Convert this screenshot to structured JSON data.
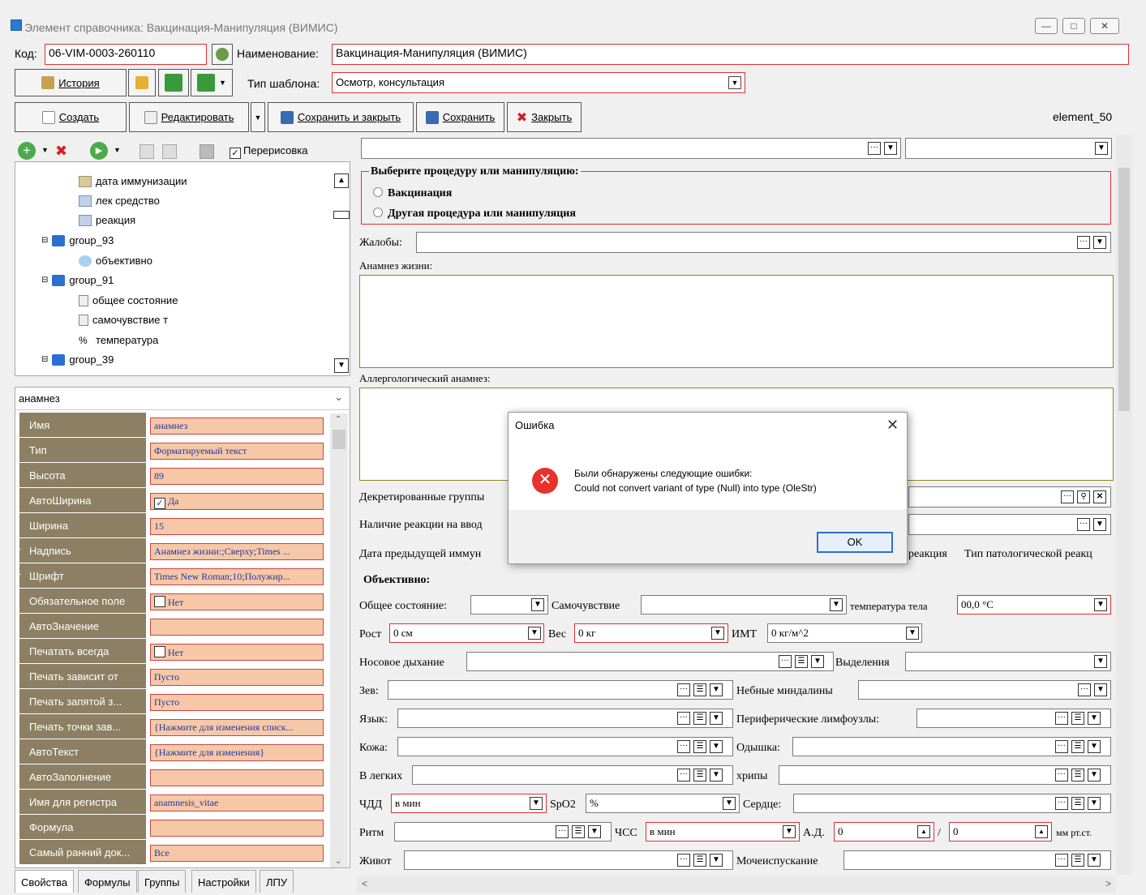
{
  "window": {
    "title": "Элемент справочника: Вакцинация-Манипуляция (ВИМИС)"
  },
  "header": {
    "code_label": "Код:",
    "code_value": "06-VIM-0003-260110",
    "name_label": "Наименование:",
    "name_value": "Вакцинация-Манипуляция (ВИМИС)",
    "history_label": "История",
    "template_type_label": "Тип шаблона:",
    "template_type_value": "Осмотр, консультация"
  },
  "toolbar": {
    "create_label": "Создать",
    "edit_label": "Редактировать",
    "save_close_label": "Сохранить и закрыть",
    "save_label": "Сохранить",
    "close_label": "Закрыть",
    "element_id": "element_50",
    "redraw_label": "Перерисовка"
  },
  "tree": {
    "items": [
      {
        "label": "дата иммунизации",
        "icon": "calendar-icon"
      },
      {
        "label": "лек средство",
        "icon": "list-icon"
      },
      {
        "label": "реакция",
        "icon": "list-icon"
      },
      {
        "label": "group_93",
        "icon": "folder-icon"
      },
      {
        "label": "объективно",
        "icon": "speech-icon"
      },
      {
        "label": "group_91",
        "icon": "folder-icon"
      },
      {
        "label": "общее состояние",
        "icon": "document-icon"
      },
      {
        "label": "самочувствие т",
        "icon": "document-icon"
      },
      {
        "label": "температура",
        "icon": "percent-icon"
      },
      {
        "label": "group_39",
        "icon": "folder-icon"
      }
    ]
  },
  "props": {
    "selector_value": "анамнез",
    "rows": [
      {
        "name": "Имя",
        "value": "анамнез"
      },
      {
        "name": "Тип",
        "value": "Форматируемый текст"
      },
      {
        "name": "Высота",
        "value": "89"
      },
      {
        "name": "АвтоШирина",
        "value": "Да",
        "checked": true
      },
      {
        "name": "Ширина",
        "value": "15"
      },
      {
        "name": "Надпись",
        "value": "Анамнез жизни:;Сверху;Times ..."
      },
      {
        "name": "Шрифт",
        "value": "Times New Roman;10;Полужир..."
      },
      {
        "name": "Обязательное поле",
        "value": "Нет",
        "checked": false
      },
      {
        "name": "АвтоЗначение",
        "value": ""
      },
      {
        "name": "Печатать всегда",
        "value": "Нет",
        "checked": false
      },
      {
        "name": "Печать зависит от",
        "value": "Пусто"
      },
      {
        "name": "Печать запятой з...",
        "value": "Пусто"
      },
      {
        "name": "Печать точки зав...",
        "value": "{Нажмите для изменения списк..."
      },
      {
        "name": "АвтоТекст",
        "value": "{Нажмите для изменения}"
      },
      {
        "name": "АвтоЗаполнение",
        "value": ""
      },
      {
        "name": "Имя для регистра",
        "value": "anamnesis_vitae"
      },
      {
        "name": "Формула",
        "value": ""
      },
      {
        "name": "Самый ранний док...",
        "value": "Все"
      }
    ]
  },
  "tabs": [
    "Свойства",
    "Формулы",
    "Группы",
    "Настройки",
    "ЛПУ"
  ],
  "form": {
    "procedure_group_label": "Выберите процедуру или манипуляцию:",
    "option_vaccination": "Вакцинация",
    "option_other": "Другая процедура или манипуляция",
    "complaints_label": "Жалобы:",
    "anamnesis_life_label": "Анамнез жизни:",
    "allergy_label": "Аллергологический анамнез:",
    "decreed_groups_label": "Декретированные группы",
    "reaction_presence_label": "Наличие реакции на ввод",
    "prev_immun_date_label": "Дата предыдущей иммун",
    "reaction_label": "реакция",
    "pathology_type_label": "Тип патологической реакц",
    "objective_label": "Объективно:",
    "general_state_label": "Общее состояние:",
    "wellbeing_label": "Самочувствие",
    "body_temp_label": "температура тела",
    "body_temp_value": "00,0 °C",
    "height_label": "Рост",
    "height_value": "0 см",
    "weight_label": "Вес",
    "weight_value": "0 кг",
    "bmi_label": "ИМТ",
    "bmi_value": "0 кг/м^2",
    "nasal_label": "Носовое дыхание",
    "discharge_label": "Выделения",
    "throat_label": "Зев:",
    "tonsils_label": "Небные миндалины",
    "tongue_label": "Язык:",
    "lymph_label": "Периферические лимфоузлы:",
    "skin_label": "Кожа:",
    "dyspnea_label": "Одышка:",
    "lungs_label": "В легких",
    "rales_label": "хрипы",
    "rr_label": "ЧДД",
    "rr_value": "в мин",
    "spo2_label": "SpO2",
    "spo2_value": "%",
    "heart_label": "Сердце:",
    "rhythm_label": "Ритм",
    "hr_label": "ЧСС",
    "hr_value": "в мин",
    "bp_label": "А.Д.",
    "bp_sys": "0",
    "bp_sep": "/",
    "bp_dia": "0",
    "bp_unit": "мм рт.ст.",
    "abdomen_label": "Живот",
    "urination_label": "Мочеиспускание"
  },
  "dialog": {
    "title": "Ошибка",
    "line1": "Были обнаружены следующие ошибки:",
    "line2": "Could not convert variant of type (Null) into type (OleStr)",
    "ok_label": "OK"
  },
  "colors": {
    "accent_red": "#e03030",
    "prop_name_bg": "#8d7f63",
    "prop_value_bg": "#f6c8a8",
    "error_red": "#e8322b"
  }
}
